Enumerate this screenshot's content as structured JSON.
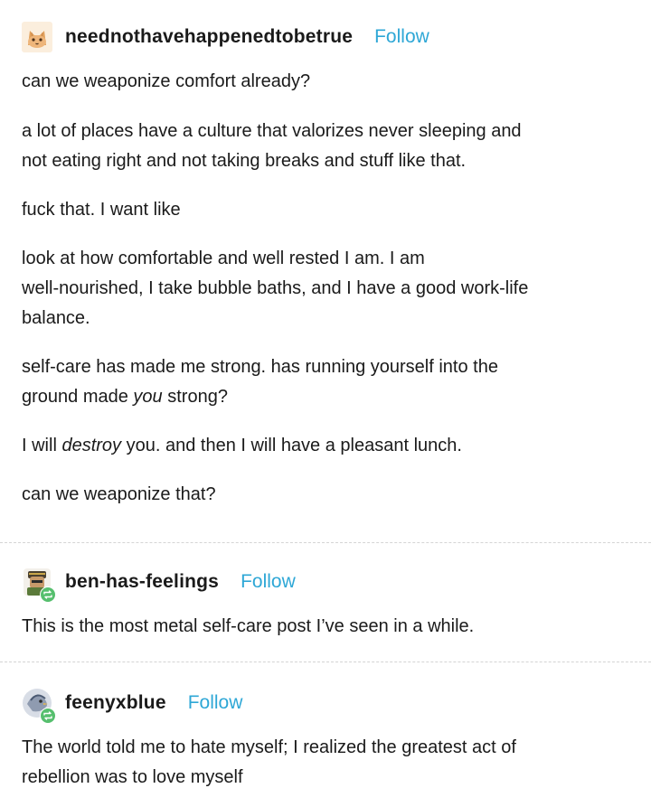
{
  "posts": [
    {
      "username": "neednothavehappenedtobetrue",
      "follow_label": "Follow",
      "avatar_icon": "cat-avatar-icon",
      "paragraphs": {
        "p1": "can we weaponize comfort already?",
        "p2a": "a lot of places have a culture that valorizes never sleeping and",
        "p2b": "not eating right and not taking breaks and stuff like that.",
        "p3": "fuck that. I want like",
        "p4a": "look at how comfortable and well rested I am. I am",
        "p4b": "well-nourished, I take bubble baths, and I have a good work-life",
        "p4c": "balance.",
        "p5a": "self-care has made me strong. has running yourself into the",
        "p5b_pre": "ground made ",
        "p5b_em": "you",
        "p5b_post": " strong?",
        "p6_pre": "I will ",
        "p6_em": "destroy",
        "p6_post": " you. and then I will have a pleasant lunch.",
        "p7": "can we weaponize that?"
      }
    },
    {
      "username": "ben-has-feelings",
      "follow_label": "Follow",
      "avatar_icon": "character-avatar-icon",
      "badge_icon": "reblog-icon",
      "text": "This is the most metal self-care post I’ve seen in a while."
    },
    {
      "username": "feenyxblue",
      "follow_label": "Follow",
      "avatar_icon": "bird-avatar-icon",
      "badge_icon": "reblog-icon",
      "text_a": "The world told me to hate myself; I realized the greatest act of",
      "text_b": "rebellion was to love myself"
    }
  ],
  "colors": {
    "follow": "#2ea7d6",
    "text": "#1a1a1a",
    "reblog_badge": "#56bf6e",
    "divider": "#d4d4d4"
  }
}
